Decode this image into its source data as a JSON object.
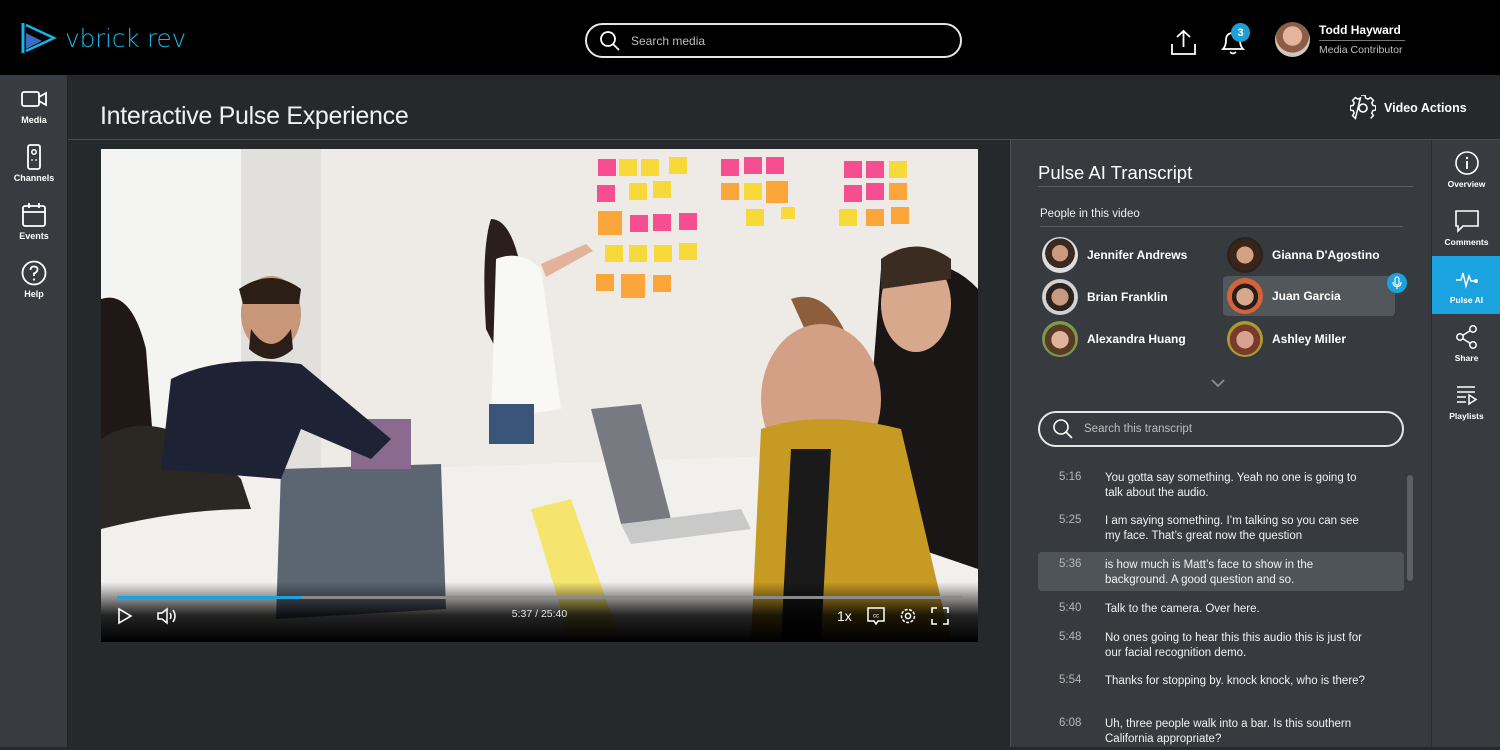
{
  "header": {
    "logo_text": "vbrick rev",
    "search_placeholder": "Search media",
    "notification_count": "3",
    "user": {
      "name": "Todd Hayward",
      "role": "Media Contributor"
    }
  },
  "leftnav": [
    {
      "label": "Media",
      "icon": "video-camera-icon"
    },
    {
      "label": "Channels",
      "icon": "remote-icon"
    },
    {
      "label": "Events",
      "icon": "calendar-icon"
    },
    {
      "label": "Help",
      "icon": "help-icon"
    }
  ],
  "page": {
    "title": "Interactive Pulse Experience",
    "video_actions_label": "Video Actions"
  },
  "player": {
    "current_time": "5:37",
    "duration": "25:40",
    "timecode": "5:37 / 25:40",
    "progress_fraction": 0.219,
    "speed": "1x",
    "accent_color": "#1aa3de"
  },
  "transcript_panel": {
    "title": "Pulse AI Transcript",
    "people_label": "People in this video",
    "people": [
      {
        "name": "Jennifer Andrews",
        "active": false
      },
      {
        "name": "Gianna D'Agostino",
        "active": false
      },
      {
        "name": "Brian Franklin",
        "active": false
      },
      {
        "name": "Juan Garcia",
        "active": true,
        "speaking": true
      },
      {
        "name": "Alexandra Huang",
        "active": false
      },
      {
        "name": "Ashley Miller",
        "active": false
      }
    ],
    "search_placeholder": "Search this transcript",
    "lines": [
      {
        "time": "5:16",
        "text": "You gotta say something. Yeah no one is going to talk about the audio.",
        "active": false
      },
      {
        "time": "5:25",
        "text": "I am saying something. I’m talking so you can see my face. That’s great now the question",
        "active": false
      },
      {
        "time": "5:36",
        "text": "is how much is Matt’s face to show in the background. A good question and so.",
        "active": true
      },
      {
        "time": "5:40",
        "text": "Talk to the camera. Over here.",
        "active": false
      },
      {
        "time": "5:48",
        "text": "No ones going to hear this this audio this is just for our facial recognition demo.",
        "active": false
      },
      {
        "time": "5:54",
        "text": "Thanks for stopping by. knock knock, who is there?",
        "active": false
      },
      {
        "time": "6:08",
        "text": "Uh, three people walk into a bar. Is this southern California appropriate?",
        "active": false
      }
    ]
  },
  "rightnav": [
    {
      "label": "Overview",
      "icon": "info-icon",
      "active": false
    },
    {
      "label": "Comments",
      "icon": "comment-icon",
      "active": false
    },
    {
      "label": "Pulse AI",
      "icon": "pulse-icon",
      "active": true
    },
    {
      "label": "Share",
      "icon": "share-icon",
      "active": false
    },
    {
      "label": "Playlists",
      "icon": "playlist-icon",
      "active": false
    }
  ]
}
